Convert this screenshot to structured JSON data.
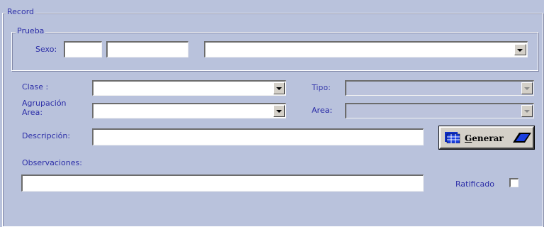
{
  "record": {
    "legend": "Record",
    "prueba": {
      "legend": "Prueba",
      "sexo_label": "Sexo:",
      "sexo_code": "",
      "sexo_desc": "",
      "sexo_select": ""
    },
    "clase": {
      "label": "Clase :",
      "value": ""
    },
    "tipo": {
      "label": "Tipo:",
      "value": ""
    },
    "agrupacion": {
      "label_line1": "Agrupación",
      "label_line2": "Area:",
      "value": ""
    },
    "area": {
      "label": "Area:",
      "value": ""
    },
    "descripcion": {
      "label": "Descripción:",
      "value": ""
    },
    "generar": {
      "label_first": "G",
      "label_rest": "enerar"
    },
    "observaciones": {
      "label": "Observaciones:",
      "value": ""
    },
    "ratificado": {
      "label": "Ratificado",
      "checked": false
    }
  }
}
